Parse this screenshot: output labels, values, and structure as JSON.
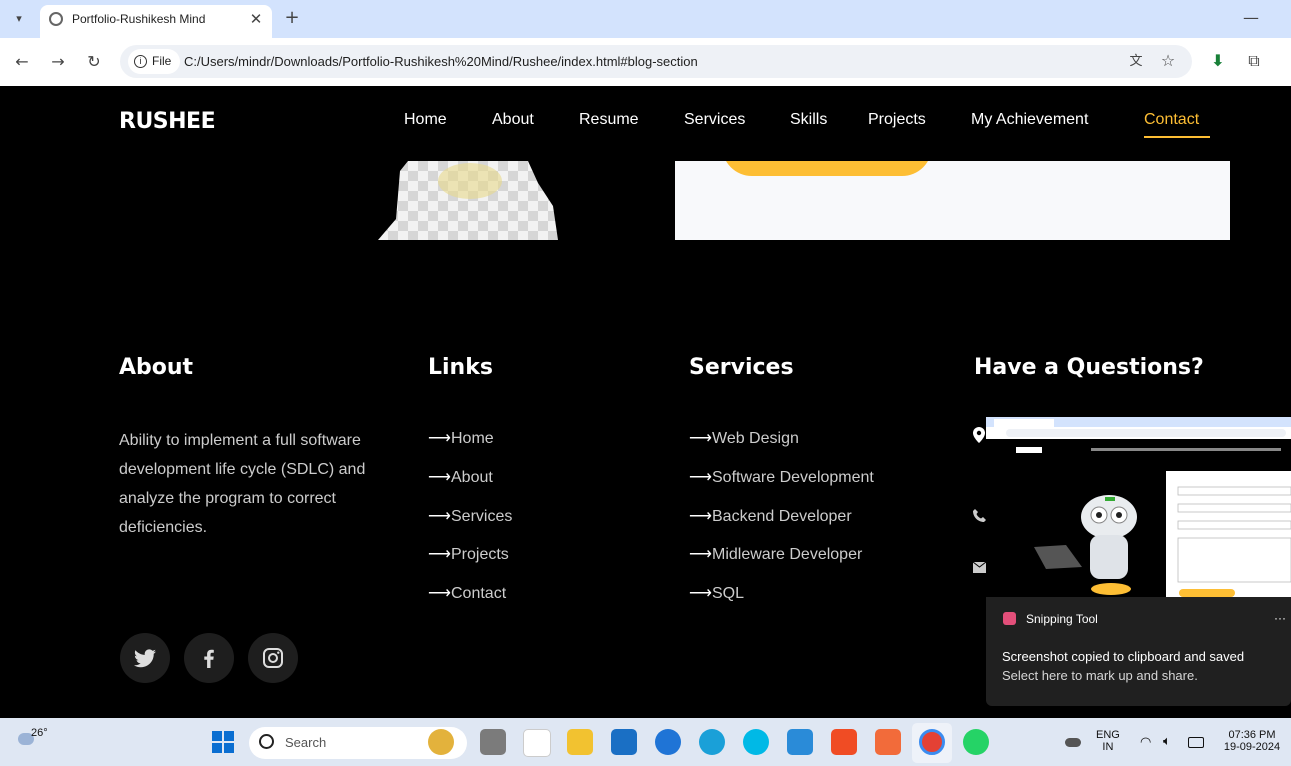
{
  "browser": {
    "tab_title": "Portfolio-Rushikesh Mind",
    "file_label": "File",
    "url": "C:/Users/mindr/Downloads/Portfolio-Rushikesh%20Mind/Rushee/index.html#blog-section"
  },
  "site": {
    "logo": "RUSHEE",
    "nav": [
      "Home",
      "About",
      "Resume",
      "Services",
      "Skills",
      "Projects",
      "My Achievement",
      "Contact"
    ],
    "active_nav": "Contact",
    "accent_color": "#fdbe34"
  },
  "footer": {
    "about": {
      "heading": "About",
      "text": "Ability to implement a full software development life cycle (SDLC) and analyze the program to correct deficiencies."
    },
    "links": {
      "heading": "Links",
      "items": [
        "Home",
        "About",
        "Services",
        "Projects",
        "Contact"
      ]
    },
    "services": {
      "heading": "Services",
      "items": [
        "Web Design",
        "Software Development",
        "Backend Developer",
        "Midleware Developer",
        "SQL"
      ]
    },
    "questions": {
      "heading": "Have a Questions?"
    },
    "social": [
      "twitter-icon",
      "facebook-icon",
      "instagram-icon"
    ]
  },
  "snipping": {
    "app": "Snipping Tool",
    "message": "Screenshot copied to clipboard and saved",
    "sub": "Select here to mark up and share.",
    "more": "···"
  },
  "taskbar": {
    "weather": "26°",
    "search": "Search",
    "lang1": "ENG",
    "lang2": "IN",
    "time": "07:36 PM",
    "date": "19-09-2024"
  }
}
